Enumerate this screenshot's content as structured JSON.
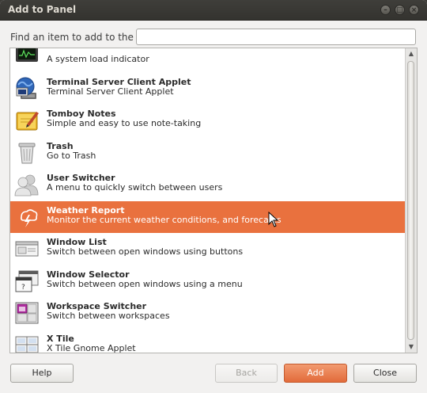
{
  "window": {
    "title": "Add to Panel"
  },
  "search": {
    "label": "Find an item to add to the panel:",
    "value": "",
    "placeholder": ""
  },
  "items": [
    {
      "name": "",
      "desc": "A system load indicator",
      "icon": "system-monitor-icon"
    },
    {
      "name": "Terminal Server Client Applet",
      "desc": "Terminal Server Client Applet",
      "icon": "terminal-server-icon"
    },
    {
      "name": "Tomboy Notes",
      "desc": "Simple and easy to use note-taking",
      "icon": "notes-icon"
    },
    {
      "name": "Trash",
      "desc": "Go to Trash",
      "icon": "trash-icon"
    },
    {
      "name": "User Switcher",
      "desc": "A menu to quickly switch between users",
      "icon": "users-icon"
    },
    {
      "name": "Weather Report",
      "desc": "Monitor the current weather conditions, and forecasts",
      "icon": "weather-icon",
      "selected": true
    },
    {
      "name": "Window List",
      "desc": "Switch between open windows using buttons",
      "icon": "window-list-icon"
    },
    {
      "name": "Window Selector",
      "desc": "Switch between open windows using a menu",
      "icon": "window-selector-icon"
    },
    {
      "name": "Workspace Switcher",
      "desc": "Switch between workspaces",
      "icon": "workspace-switcher-icon"
    },
    {
      "name": "X Tile",
      "desc": "X Tile Gnome Applet",
      "icon": "xtile-icon"
    }
  ],
  "buttons": {
    "help": "Help",
    "back": "Back",
    "add": "Add",
    "close": "Close"
  },
  "colors": {
    "selection": "#e9713e",
    "accent_button": "#e26b3a",
    "titlebar": "#3c3b37"
  }
}
